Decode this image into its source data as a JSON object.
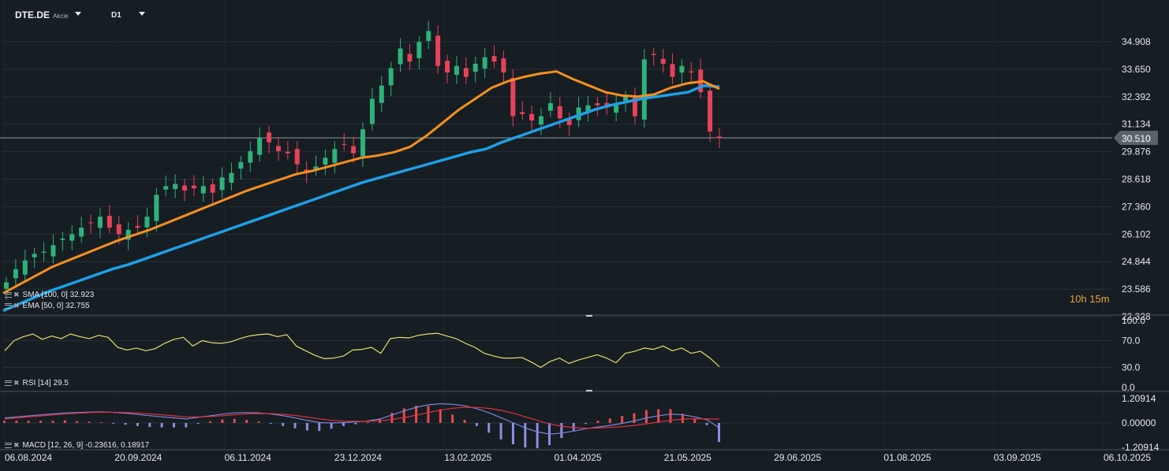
{
  "header": {
    "symbol": "DTE.DE",
    "symbol_type": "Akcie",
    "timeframe": "D1"
  },
  "indicators": {
    "sma": "SMA [100, 0]  32.923",
    "ema": "EMA [50, 0]  32.755",
    "rsi": "RSI [14]  29.5",
    "macd": "MACD [12, 26, 9]  -0.23616,  0.18917"
  },
  "countdown": "10h 15m",
  "colors": {
    "background": "#161d23",
    "up": "#2db37a",
    "down": "#e8425a",
    "sma": "#1ea0e8",
    "ema": "#f5901e",
    "rsi": "#e6e06a",
    "macd_line": "#7b86d8",
    "signal_line": "#e0303c",
    "hist_pos": "#e84a50",
    "hist_neg": "#8a8fe0"
  },
  "chart_data": {
    "type": "candlestick",
    "x_dates": [
      "06.08.2024",
      "20.09.2024",
      "06.11.2024",
      "23.12.2024",
      "13.02.2025",
      "01.04.2025",
      "21.05.2025",
      "29.06.2025",
      "01.08.2025",
      "03.09.2025",
      "06.10.2025"
    ],
    "price_ticks": [
      "34.908",
      "33.650",
      "32.392",
      "31.134",
      "29.876",
      "28.618",
      "27.360",
      "26.102",
      "24.844",
      "23.586",
      "22.328"
    ],
    "price_range": [
      22.328,
      35.9
    ],
    "last_price": "30.510",
    "close_series": [
      23.9,
      24.5,
      24.9,
      25.2,
      25.3,
      25.6,
      25.9,
      26.1,
      26.4,
      26.6,
      26.9,
      26.4,
      26.1,
      26.3,
      26.4,
      26.9,
      27.9,
      28.3,
      28.4,
      28.1,
      28.2,
      28.3,
      28.0,
      28.7,
      28.9,
      29.4,
      29.9,
      30.5,
      30.3,
      29.9,
      29.8,
      29.3,
      28.9,
      29.2,
      29.6,
      30.0,
      30.2,
      29.8,
      30.9,
      32.3,
      32.9,
      33.7,
      34.6,
      34.0,
      34.9,
      35.4,
      33.8,
      33.5,
      33.8,
      33.3,
      33.9,
      34.2,
      34.0,
      33.5,
      31.5,
      31.6,
      31.3,
      31.5,
      32.1,
      31.4,
      31.1,
      31.9,
      32.0,
      32.0,
      31.9,
      32.0,
      32.4,
      31.5,
      34.1,
      34.3,
      33.9,
      33.3,
      33.8,
      33.5,
      32.6,
      30.8,
      30.5
    ],
    "sma100_series": [
      22.6,
      22.9,
      23.2,
      23.5,
      23.75,
      24.0,
      24.25,
      24.5,
      24.7,
      24.95,
      25.2,
      25.45,
      25.7,
      25.95,
      26.2,
      26.45,
      26.7,
      26.95,
      27.2,
      27.45,
      27.7,
      27.95,
      28.2,
      28.45,
      28.65,
      28.85,
      29.05,
      29.25,
      29.45,
      29.65,
      29.85,
      30.0,
      30.3,
      30.55,
      30.8,
      31.05,
      31.3,
      31.55,
      31.8,
      32.0,
      32.15,
      32.3,
      32.4,
      32.5,
      32.6,
      32.9,
      32.85
    ],
    "ema50_series": [
      23.4,
      23.8,
      24.2,
      24.6,
      24.9,
      25.2,
      25.5,
      25.8,
      26.05,
      26.3,
      26.6,
      26.9,
      27.2,
      27.5,
      27.8,
      28.1,
      28.35,
      28.6,
      28.85,
      29.0,
      29.2,
      29.4,
      29.6,
      29.7,
      29.85,
      30.1,
      30.6,
      31.2,
      31.8,
      32.3,
      32.8,
      33.1,
      33.3,
      33.45,
      33.55,
      33.2,
      32.9,
      32.6,
      32.45,
      32.4,
      32.5,
      32.8,
      33.0,
      33.1,
      32.75
    ],
    "rsi": {
      "ticks": [
        "100.0",
        "70.0",
        "30.0",
        "0.0"
      ],
      "value": 29.5
    },
    "rsi_series": [
      55,
      70,
      76,
      80,
      72,
      77,
      73,
      80,
      76,
      73,
      78,
      75,
      60,
      56,
      59,
      55,
      58,
      66,
      72,
      75,
      62,
      70,
      67,
      66,
      68,
      73,
      77,
      79,
      80,
      76,
      79,
      62,
      55,
      48,
      43,
      44,
      47,
      56,
      57,
      60,
      51,
      73,
      75,
      74,
      78,
      80,
      81,
      77,
      73,
      66,
      60,
      51,
      47,
      44,
      44,
      45,
      38,
      30,
      39,
      44,
      36,
      41,
      45,
      49,
      44,
      37,
      51,
      54,
      59,
      57,
      62,
      55,
      59,
      51,
      54,
      44,
      31
    ],
    "macd": {
      "ticks": [
        "1.20914",
        "0.00000",
        "-1.20914"
      ],
      "macd": -0.23616,
      "signal": 0.18917
    },
    "macd_series": [
      0.25,
      0.3,
      0.35,
      0.4,
      0.45,
      0.5,
      0.52,
      0.54,
      0.55,
      0.52,
      0.48,
      0.42,
      0.36,
      0.3,
      0.25,
      0.2,
      0.28,
      0.36,
      0.44,
      0.5,
      0.52,
      0.5,
      0.44,
      0.36,
      0.25,
      0.12,
      0.02,
      0.0,
      0.02,
      0.05,
      0.1,
      0.2,
      0.4,
      0.6,
      0.78,
      0.9,
      0.95,
      0.92,
      0.85,
      0.7,
      0.5,
      0.25,
      0.0,
      -0.25,
      -0.45,
      -0.55,
      -0.5,
      -0.4,
      -0.28,
      -0.2,
      -0.12,
      -0.02,
      0.1,
      0.25,
      0.36,
      0.44,
      0.4,
      0.3,
      0.15,
      -0.24
    ],
    "signal_series": [
      0.2,
      0.25,
      0.3,
      0.35,
      0.4,
      0.44,
      0.48,
      0.51,
      0.53,
      0.53,
      0.52,
      0.49,
      0.45,
      0.4,
      0.35,
      0.3,
      0.3,
      0.32,
      0.36,
      0.41,
      0.45,
      0.47,
      0.46,
      0.43,
      0.37,
      0.29,
      0.2,
      0.13,
      0.09,
      0.08,
      0.08,
      0.11,
      0.17,
      0.27,
      0.39,
      0.52,
      0.64,
      0.73,
      0.78,
      0.77,
      0.72,
      0.62,
      0.48,
      0.3,
      0.12,
      -0.05,
      -0.16,
      -0.23,
      -0.26,
      -0.25,
      -0.22,
      -0.18,
      -0.12,
      -0.04,
      0.05,
      0.13,
      0.19,
      0.21,
      0.2,
      0.19
    ]
  }
}
